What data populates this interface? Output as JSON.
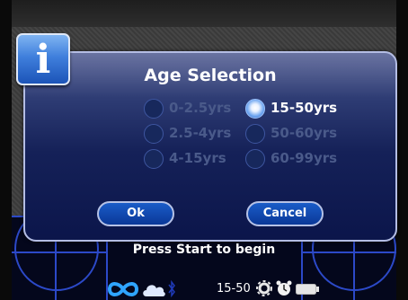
{
  "dialog": {
    "title": "Age Selection",
    "options": [
      {
        "label": "0-2.5yrs",
        "selected": false
      },
      {
        "label": "2.5-4yrs",
        "selected": false
      },
      {
        "label": "4-15yrs",
        "selected": false
      },
      {
        "label": "15-50yrs",
        "selected": true
      },
      {
        "label": "50-60yrs",
        "selected": false
      },
      {
        "label": "60-99yrs",
        "selected": false
      }
    ],
    "ok_label": "Ok",
    "cancel_label": "Cancel",
    "info_glyph": "i"
  },
  "background": {
    "start_message": "Press Start to begin"
  },
  "status": {
    "range": "15-50",
    "icons": [
      "infinity-icon",
      "cloud-icon",
      "bluetooth-icon",
      "gear-icon",
      "clock-icon",
      "battery-icon"
    ]
  },
  "colors": {
    "accent": "#2c49c8",
    "dialog_dark": "#0b154a",
    "selected_radio": "#6fa6f0"
  }
}
